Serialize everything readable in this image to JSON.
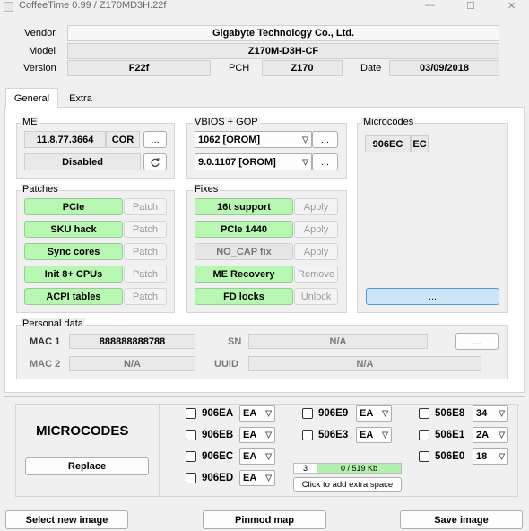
{
  "window": {
    "title": "CoffeeTime 0.99  /  Z170MD3H.22f",
    "minimize": "—",
    "maximize": "☐",
    "close": "✕"
  },
  "info": {
    "vendor_label": "Vendor",
    "vendor": "Gigabyte Technology Co., Ltd.",
    "model_label": "Model",
    "model": "Z170M-D3H-CF",
    "version_label": "Version",
    "version": "F22f",
    "pch_label": "PCH",
    "pch": "Z170",
    "date_label": "Date",
    "date": "03/09/2018"
  },
  "tabs": [
    "General",
    "Extra"
  ],
  "me": {
    "title": "ME",
    "version": "11.8.77.3664",
    "type": "COR",
    "more": "...",
    "state": "Disabled",
    "refresh_icon": "refresh-icon"
  },
  "vbios": {
    "title": "VBIOS + GOP",
    "vbios": "1062 [OROM]",
    "gop": "9.0.1107 [OROM]",
    "more": "..."
  },
  "microcodes_box": {
    "title": "Microcodes",
    "cpuid": "906EC",
    "ver": "EC",
    "button": "..."
  },
  "patches": {
    "title": "Patches",
    "items": [
      {
        "name": "PCIe",
        "action": "Patch"
      },
      {
        "name": "SKU hack",
        "action": "Patch"
      },
      {
        "name": "Sync cores",
        "action": "Patch"
      },
      {
        "name": "Init 8+ CPUs",
        "action": "Patch"
      },
      {
        "name": "ACPI tables",
        "action": "Patch"
      }
    ]
  },
  "fixes": {
    "title": "Fixes",
    "items": [
      {
        "name": "16t support",
        "action": "Apply"
      },
      {
        "name": "PCIe 1440",
        "action": "Apply"
      },
      {
        "name": "NO_CAP fix",
        "action": "Apply"
      },
      {
        "name": "ME Recovery",
        "action": "Remove"
      },
      {
        "name": "FD locks",
        "action": "Unlock"
      }
    ]
  },
  "personal": {
    "title": "Personal data",
    "mac1_label": "MAC 1",
    "mac1": "888888888788",
    "sn_label": "SN",
    "sn": "N/A",
    "more": "...",
    "mac2_label": "MAC 2",
    "mac2": "N/A",
    "uuid_label": "UUID",
    "uuid": "N/A"
  },
  "bottom": {
    "microcodes_title": "MICROCODES",
    "replace": "Replace",
    "codes": [
      {
        "cpuid": "906EA",
        "ver": "EA"
      },
      {
        "cpuid": "906EB",
        "ver": "EA"
      },
      {
        "cpuid": "906EC",
        "ver": "EA"
      },
      {
        "cpuid": "906ED",
        "ver": "EA"
      },
      {
        "cpuid": "906E9",
        "ver": "EA"
      },
      {
        "cpuid": "506E3",
        "ver": "EA"
      },
      {
        "cpuid": "506E8",
        "ver": "34"
      },
      {
        "cpuid": "506E1",
        "ver": "2A"
      },
      {
        "cpuid": "506E0",
        "ver": "18"
      }
    ],
    "count": "3",
    "space": "0 / 519 Kb",
    "add_space": "Click to add extra space"
  },
  "footer": {
    "select_image": "Select new image",
    "pinmod_map": "Pinmod map",
    "save_image": "Save image"
  }
}
